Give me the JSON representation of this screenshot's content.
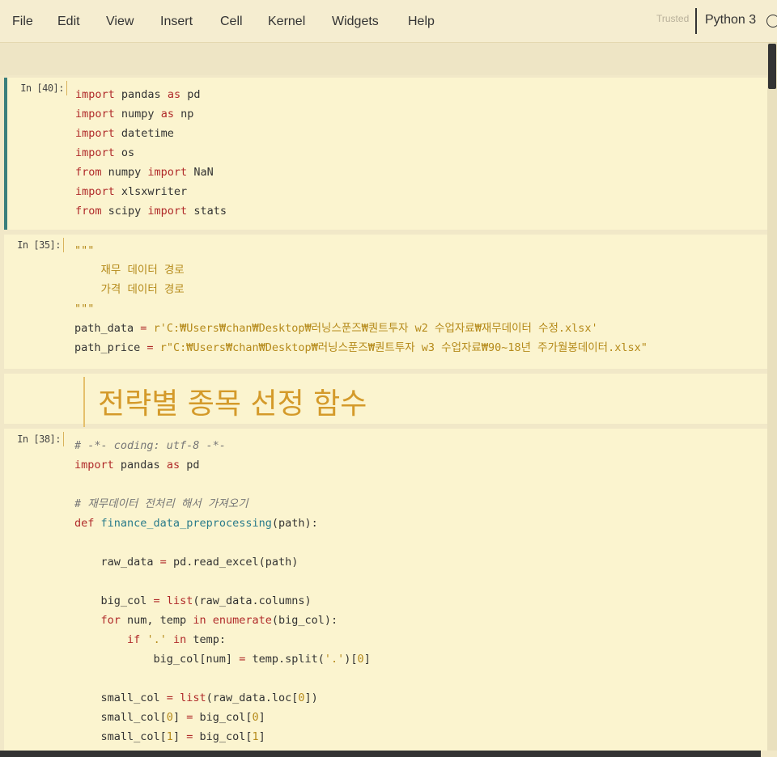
{
  "menu": {
    "items": [
      "File",
      "Edit",
      "View",
      "Insert",
      "Cell",
      "Kernel",
      "Widgets",
      "Help"
    ],
    "trusted": "Trusted",
    "kernel": "Python 3"
  },
  "cells": {
    "c1": {
      "prompt": "In [40]:",
      "lines": [
        "import pandas as pd",
        "import numpy as np",
        "import datetime",
        "import os",
        "from numpy import NaN",
        "import xlsxwriter",
        "from scipy import stats"
      ]
    },
    "c2": {
      "prompt": "In [35]:",
      "lines": [
        "\"\"\"",
        "    재무 데이터 경로",
        "    가격 데이터 경로",
        "\"\"\"",
        "path_data = r'C:₩Users₩chan₩Desktop₩러닝스푼즈₩퀀트투자 w2 수업자료₩재무데이터 수정.xlsx'",
        "path_price = r\"C:₩Users₩chan₩Desktop₩러닝스푼즈₩퀀트투자 w3 수업자료₩90~18년 주가월봉데이터.xlsx\""
      ]
    },
    "md": {
      "heading": "전략별 종목 선정 함수"
    },
    "c3": {
      "prompt": "In [38]:",
      "lines": [
        "# -*- coding: utf-8 -*-",
        "import pandas as pd",
        "",
        "# 재무데이터 전처리 해서 가져오기",
        "def finance_data_preprocessing(path):",
        "",
        "    raw_data = pd.read_excel(path)",
        "",
        "    big_col = list(raw_data.columns)",
        "    for num, temp in enumerate(big_col):",
        "        if '.' in temp:",
        "            big_col[num] = temp.split('.')[0]",
        "",
        "    small_col = list(raw_data.loc[0])",
        "    small_col[0] = big_col[0]",
        "    small_col[1] = big_col[1]"
      ]
    }
  },
  "colors": {
    "selected_border": "#3b7f7c",
    "keyword": "#b02a2a",
    "string": "#b58a1a",
    "heading": "#d49a2a"
  }
}
